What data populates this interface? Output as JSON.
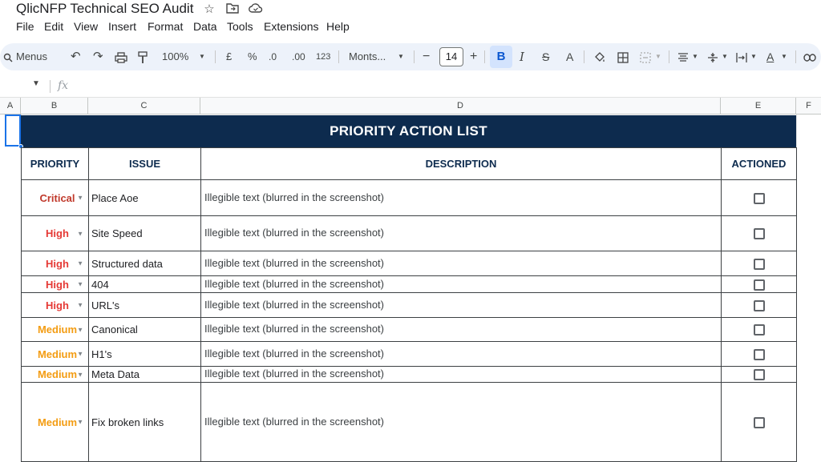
{
  "app": {
    "title": "QlicNFP Technical SEO Audit",
    "title_icons": [
      "star-icon",
      "folder-move-icon",
      "cloud-status-icon"
    ]
  },
  "menu": [
    "File",
    "Edit",
    "View",
    "Insert",
    "Format",
    "Data",
    "Tools",
    "Extensions",
    "Help"
  ],
  "toolbar": {
    "menus_label": "Menus",
    "zoom": "100%",
    "currency": "£",
    "percent": "%",
    "dec_decrease": ".0",
    "dec_increase": ".00",
    "number_format": "123",
    "font": "Monts...",
    "font_size": "14",
    "bold": "B",
    "italic": "I",
    "strike": "S",
    "text_color": "A"
  },
  "formula": {
    "fx": "fx",
    "value": ""
  },
  "columns": [
    "A",
    "B",
    "C",
    "D",
    "E",
    "F"
  ],
  "sheet": {
    "banner": "PRIORITY ACTION LIST",
    "headers": {
      "priority": "PRIORITY",
      "issue": "ISSUE",
      "description": "DESCRIPTION",
      "actioned": "ACTIONED"
    },
    "rows": [
      {
        "priority": "Critical",
        "level": "critical",
        "issue": "Place Aoe",
        "description": "Illegible text (blurred in the screenshot)",
        "actioned": false
      },
      {
        "priority": "High",
        "level": "high",
        "issue": "Site Speed",
        "description": "Illegible text (blurred in the screenshot)",
        "actioned": false
      },
      {
        "priority": "High",
        "level": "high",
        "issue": "Structured data",
        "description": "Illegible text (blurred in the screenshot)",
        "actioned": false
      },
      {
        "priority": "High",
        "level": "high",
        "issue": "404",
        "description": "Illegible text (blurred in the screenshot)",
        "actioned": false
      },
      {
        "priority": "High",
        "level": "high",
        "issue": "URL's",
        "description": "Illegible text (blurred in the screenshot)",
        "actioned": false
      },
      {
        "priority": "Medium",
        "level": "medium",
        "issue": "Canonical",
        "description": "Illegible text (blurred in the screenshot)",
        "actioned": false
      },
      {
        "priority": "Medium",
        "level": "medium",
        "issue": "H1's",
        "description": "Illegible text (blurred in the screenshot)",
        "actioned": false
      },
      {
        "priority": "Medium",
        "level": "medium",
        "issue": "Meta Data",
        "description": "Illegible text (blurred in the screenshot)",
        "actioned": false
      },
      {
        "priority": "Medium",
        "level": "medium",
        "issue": "Fix broken links",
        "description": "Illegible text (blurred in the screenshot)",
        "actioned": false
      }
    ]
  },
  "colors": {
    "banner_bg": "#0d2b4e",
    "critical": "#c0392b",
    "high": "#e53935",
    "medium": "#f39c12"
  }
}
